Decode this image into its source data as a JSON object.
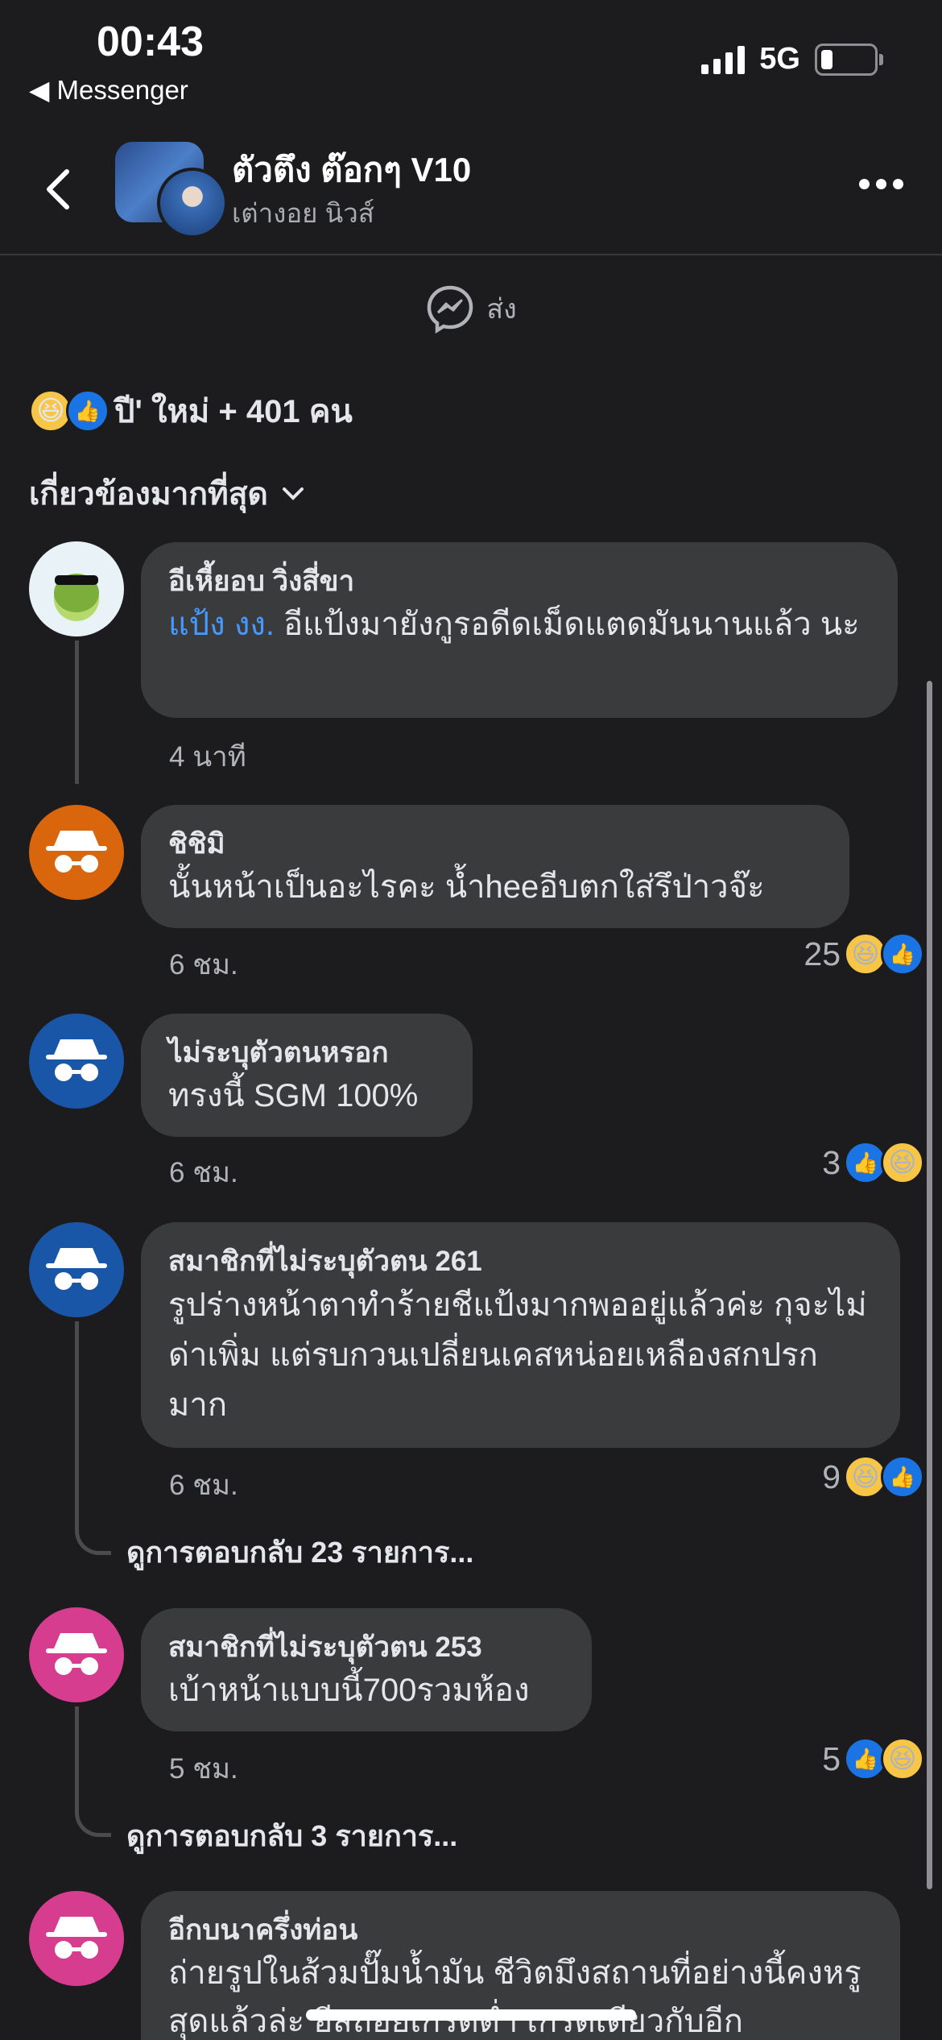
{
  "status": {
    "time": "00:43",
    "back_app": "◀ Messenger",
    "network": "5G"
  },
  "header": {
    "title": "ตัวตึง ต๊อกๆ V10",
    "subtitle": "เต่างอย นิวส์"
  },
  "share": {
    "label": "ส่ง"
  },
  "reactions": {
    "summary": "ปี' ใหม่ + 401 คน"
  },
  "sort": {
    "label": "เกี่ยวข้องมากที่สุด"
  },
  "comments": [
    {
      "author": "อีเหี้ยอบ วิ่งสี่ขา",
      "mention": "แป้ง งง.",
      "text": " อีแป้งมายังกูรอดีดเม็ดแตดมันนานแล้ว นะ",
      "time": "4 นาที",
      "count": ""
    },
    {
      "author": "ชิชิมิ",
      "text": "นั้นหน้าเป็นอะไรคะ น้ำheeอีบตกใส่รึป่าวจ๊ะ",
      "time": "6 ชม.",
      "count": "25"
    },
    {
      "author": "ไม่ระบุตัวตนหรอก",
      "text": "ทรงนี้ SGM 100%",
      "time": "6 ชม.",
      "count": "3"
    },
    {
      "author": "สมาชิกที่ไม่ระบุตัวตน 261",
      "text": "รูปร่างหน้าตาทำร้ายชีแป้งมากพออยู่แล้วค่ะ กุจะไม่ด่าเพิ่ม แต่รบกวนเปลี่ยนเคสหน่อยเหลืองสกปรกมาก",
      "time": "6 ชม.",
      "count": "9",
      "replies": "ดูการตอบกลับ 23 รายการ..."
    },
    {
      "author": "สมาชิกที่ไม่ระบุตัวตน 253",
      "text": "เบ้าหน้าแบบนี้700รวมห้อง",
      "time": "5 ชม.",
      "count": "5",
      "replies": "ดูการตอบกลับ 3 รายการ..."
    },
    {
      "author": "อีกบนาครึ่งท่อน",
      "text": "ถ่ายรูปในส้วมปั๊มน้ำมัน ชีวิตมึงสถานที่อย่างนี้คงหรูสุดแล้วล่ะ อีสถอยเกรดต่ำ เกรดเดียวกับอีก",
      "time": "",
      "count": ""
    }
  ]
}
